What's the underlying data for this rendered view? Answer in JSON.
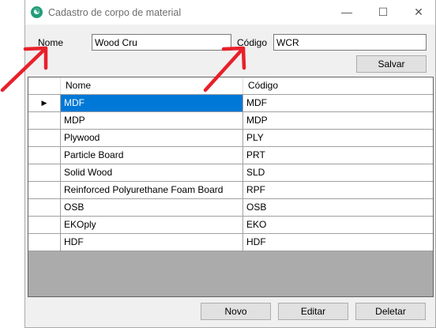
{
  "window": {
    "title": "Cadastro de corpo de material",
    "icon": "app-logo-icon",
    "controls": {
      "minimize": "—",
      "maximize": "☐",
      "close": "✕"
    }
  },
  "form": {
    "name_label": "Nome",
    "name_value": "Wood Cru",
    "code_label": "Código",
    "code_value": "WCR",
    "save_label": "Salvar"
  },
  "grid": {
    "columns": [
      "Nome",
      "Código"
    ],
    "current_row_marker": "▶",
    "rows": [
      {
        "name": "MDF",
        "code": "MDF"
      },
      {
        "name": "MDP",
        "code": "MDP"
      },
      {
        "name": "Plywood",
        "code": "PLY"
      },
      {
        "name": "Particle Board",
        "code": "PRT"
      },
      {
        "name": "Solid Wood",
        "code": "SLD"
      },
      {
        "name": "Reinforced Polyurethane Foam Board",
        "code": "RPF"
      },
      {
        "name": "OSB",
        "code": "OSB"
      },
      {
        "name": "EKOply",
        "code": "EKO"
      },
      {
        "name": "HDF",
        "code": "HDF"
      }
    ],
    "selected_index": 0
  },
  "actions": {
    "new_label": "Novo",
    "edit_label": "Editar",
    "delete_label": "Deletar"
  },
  "colors": {
    "selection": "#0078d7",
    "annotation_arrow": "#e8202a",
    "empty_grid": "#ababab"
  }
}
